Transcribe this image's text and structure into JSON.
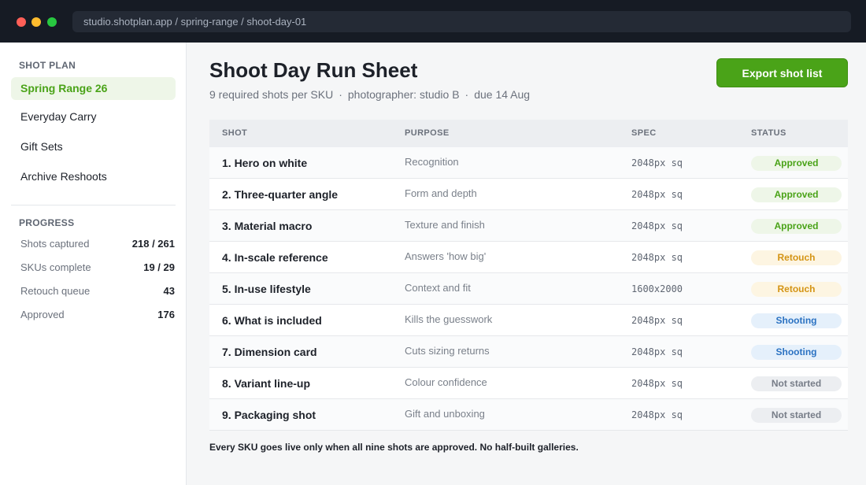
{
  "window": {
    "url": "studio.shotplan.app / spring-range / shoot-day-01"
  },
  "sidebar": {
    "shot_plan_heading": "SHOT PLAN",
    "items": [
      {
        "label": "Spring Range 26",
        "active": true
      },
      {
        "label": "Everyday Carry",
        "active": false
      },
      {
        "label": "Gift Sets",
        "active": false
      },
      {
        "label": "Archive Reshoots",
        "active": false
      }
    ],
    "progress_heading": "PROGRESS",
    "stats": [
      {
        "label": "Shots captured",
        "value": "218 / 261"
      },
      {
        "label": "SKUs complete",
        "value": "19 / 29"
      },
      {
        "label": "Retouch queue",
        "value": "43"
      },
      {
        "label": "Approved",
        "value": "176"
      }
    ]
  },
  "header": {
    "title": "Shoot Day Run Sheet",
    "meta": [
      "9 required shots per SKU",
      "photographer: studio B",
      "due 14 Aug"
    ],
    "meta_separator": "·",
    "export_label": "Export shot list"
  },
  "table": {
    "columns": [
      "SHOT",
      "PURPOSE",
      "SPEC",
      "STATUS"
    ],
    "rows": [
      {
        "shot": "1. Hero on white",
        "purpose": "Recognition",
        "spec": "2048px sq",
        "status": "Approved"
      },
      {
        "shot": "2. Three-quarter angle",
        "purpose": "Form and depth",
        "spec": "2048px sq",
        "status": "Approved"
      },
      {
        "shot": "3. Material macro",
        "purpose": "Texture and finish",
        "spec": "2048px sq",
        "status": "Approved"
      },
      {
        "shot": "4. In-scale reference",
        "purpose": "Answers 'how big'",
        "spec": "2048px sq",
        "status": "Retouch"
      },
      {
        "shot": "5. In-use lifestyle",
        "purpose": "Context and fit",
        "spec": "1600x2000",
        "status": "Retouch"
      },
      {
        "shot": "6. What is included",
        "purpose": "Kills the guesswork",
        "spec": "2048px sq",
        "status": "Shooting"
      },
      {
        "shot": "7. Dimension card",
        "purpose": "Cuts sizing returns",
        "spec": "2048px sq",
        "status": "Shooting"
      },
      {
        "shot": "8. Variant line-up",
        "purpose": "Colour confidence",
        "spec": "2048px sq",
        "status": "Not started"
      },
      {
        "shot": "9. Packaging shot",
        "purpose": "Gift and unboxing",
        "spec": "2048px sq",
        "status": "Not started"
      }
    ]
  },
  "footnote": "Every SKU goes live only when all nine shots are approved. No half-built galleries.",
  "colors": {
    "accent": "#4aa318",
    "approved": "#4aa318",
    "retouch": "#d49414",
    "shooting": "#2b72c2",
    "not_started": "#777d88"
  }
}
